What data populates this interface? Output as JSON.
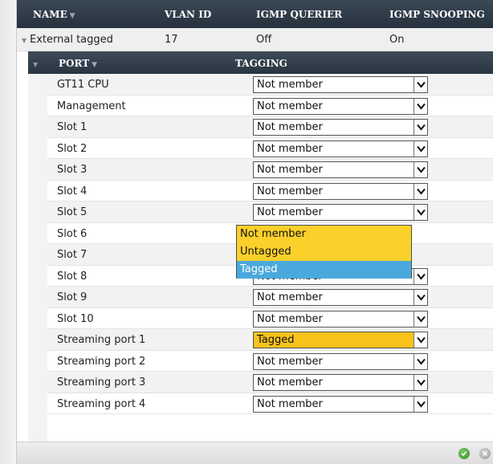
{
  "columns": {
    "name": "NAME",
    "vlan_id": "VLAN ID",
    "igmp_querier": "IGMP QUERIER",
    "igmp_snooping": "IGMP SNOOPING"
  },
  "vlan": {
    "name": "External tagged",
    "vlan_id": "17",
    "igmp_querier": "Off",
    "igmp_snooping": "On"
  },
  "sub_columns": {
    "port": "PORT",
    "tagging": "TAGGING"
  },
  "ports": [
    {
      "name": "GT11 CPU",
      "tagging": "Not member"
    },
    {
      "name": "Management",
      "tagging": "Not member"
    },
    {
      "name": "Slot 1",
      "tagging": "Not member"
    },
    {
      "name": "Slot 2",
      "tagging": "Not member"
    },
    {
      "name": "Slot 3",
      "tagging": "Not member"
    },
    {
      "name": "Slot 4",
      "tagging": "Not member"
    },
    {
      "name": "Slot 5",
      "tagging": "Not member"
    },
    {
      "name": "Slot 6",
      "tagging": ""
    },
    {
      "name": "Slot 7",
      "tagging": ""
    },
    {
      "name": "Slot 8",
      "tagging": "Not member"
    },
    {
      "name": "Slot 9",
      "tagging": "Not member"
    },
    {
      "name": "Slot 10",
      "tagging": "Not member"
    },
    {
      "name": "Streaming port 1",
      "tagging": "Tagged"
    },
    {
      "name": "Streaming port 2",
      "tagging": "Not member"
    },
    {
      "name": "Streaming port 3",
      "tagging": "Not member"
    },
    {
      "name": "Streaming port 4",
      "tagging": "Not member"
    }
  ],
  "dropdown_options": [
    "Not member",
    "Untagged",
    "Tagged"
  ],
  "dropdown_highlighted": "Tagged",
  "colors": {
    "header_bg": "#2f3b48",
    "tagged_bg": "#f7c21a",
    "option_highlight": "#4aa9dc",
    "option_yellow": "#fbd02a",
    "ok_green": "#3c8a2a"
  },
  "icons": {
    "ok": "check-circle-icon",
    "cancel": "close-circle-icon"
  }
}
